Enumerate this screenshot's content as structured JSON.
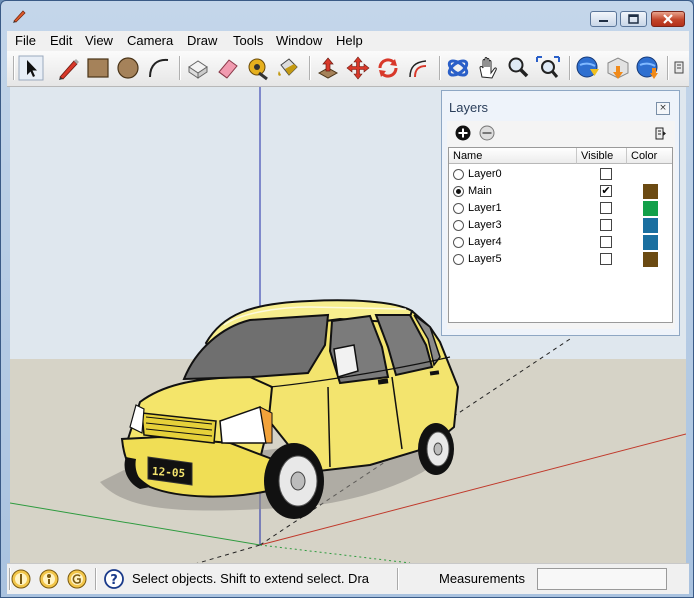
{
  "window": {
    "title": ""
  },
  "menu": [
    "File",
    "Edit",
    "View",
    "Camera",
    "Draw",
    "Tools",
    "Window",
    "Help"
  ],
  "toolbar": {
    "tools": [
      "select-tool",
      "pencil-tool",
      "rectangle-tool",
      "circle-tool",
      "arc-tool",
      "make-component-tool",
      "eraser-tool",
      "tape-measure-tool",
      "paint-bucket-tool",
      "push-pull-tool",
      "move-tool",
      "rotate-tool",
      "offset-tool",
      "orbit-tool",
      "pan-tool",
      "zoom-tool",
      "zoom-extents-tool",
      "warehouse-tool",
      "share-model-tool",
      "extension-warehouse-tool"
    ]
  },
  "viewport": {
    "license_plate": "12-05",
    "colors": {
      "sky": "#dfe7ee",
      "ground": "#d6d3c7",
      "car_body": "#f3e46e",
      "blue_axis": "#1f2ba8",
      "red_axis": "#c0392b",
      "green_axis": "#2e9b3f"
    }
  },
  "layers": {
    "title": "Layers",
    "close_symbol": "×",
    "headers": {
      "name": "Name",
      "visible": "Visible",
      "color": "Color"
    },
    "rows": [
      {
        "name": "Layer0",
        "active": false,
        "visible": false,
        "color": null
      },
      {
        "name": "Main",
        "active": true,
        "visible": true,
        "color": "#6b4a12"
      },
      {
        "name": "Layer1",
        "active": false,
        "visible": false,
        "color": "#12a04a"
      },
      {
        "name": "Layer3",
        "active": false,
        "visible": false,
        "color": "#1a6fa0"
      },
      {
        "name": "Layer4",
        "active": false,
        "visible": false,
        "color": "#1a6fa0"
      },
      {
        "name": "Layer5",
        "active": false,
        "visible": false,
        "color": "#6b4a12"
      }
    ]
  },
  "statusbar": {
    "text": "Select objects. Shift to extend select. Dra",
    "measurements_label": "Measurements",
    "measurements_value": ""
  }
}
